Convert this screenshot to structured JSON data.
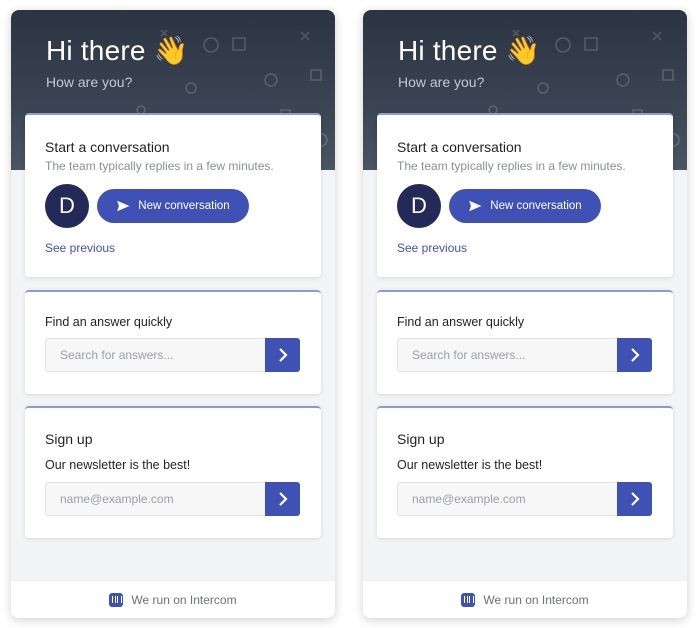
{
  "panels": [
    {
      "greeting": "Hi there",
      "wave_emoji": "👋",
      "subgreeting": "How are you?",
      "conversation": {
        "title": "Start a conversation",
        "subtitle": "The team typically replies in a few minutes.",
        "avatar_letter": "D",
        "new_button": "New conversation",
        "see_previous": "See previous"
      },
      "search": {
        "title": "Find an answer quickly",
        "placeholder": "Search for answers..."
      },
      "signup": {
        "title": "Sign up",
        "text": "Our newsletter is the best!",
        "placeholder": "name@example.com"
      },
      "footer": "We run on Intercom"
    },
    {
      "greeting": "Hi there",
      "wave_emoji": "👋",
      "subgreeting": "How are you?",
      "conversation": {
        "title": "Start a conversation",
        "subtitle": "The team typically replies in a few minutes.",
        "avatar_letter": "D",
        "new_button": "New conversation",
        "see_previous": "See previous"
      },
      "search": {
        "title": "Find an answer quickly",
        "placeholder": "Search for answers..."
      },
      "signup": {
        "title": "Sign up",
        "text": "Our newsletter is the best!",
        "placeholder": "name@example.com"
      },
      "footer": "We run on Intercom"
    }
  ],
  "colors": {
    "accent": "#3f51b5",
    "header_dark": "#2c3442",
    "avatar": "#232a5a",
    "card_top_border": "#8e9ad8"
  },
  "icons": {
    "send": "paper-plane-icon",
    "arrow": "chevron-right-icon",
    "brand": "intercom-logo-icon",
    "wave": "waving-hand-icon"
  }
}
